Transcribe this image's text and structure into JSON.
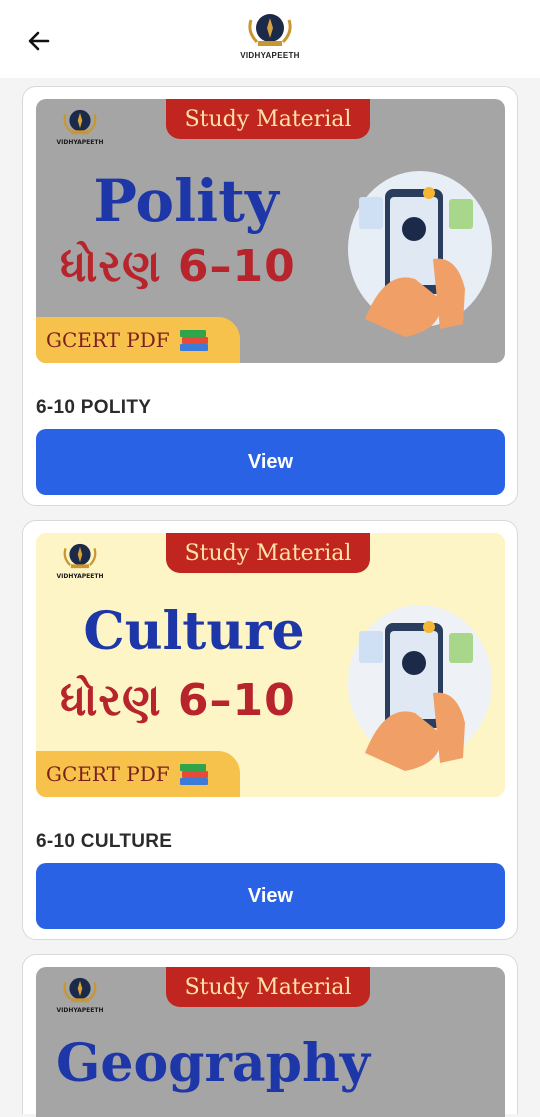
{
  "header": {
    "back_icon": "arrow-left-icon",
    "logo_text": "VIDHYAPEETH"
  },
  "cards": [
    {
      "pill": "Study Material",
      "logo_text": "VIDHYAPEETH",
      "subject": "Polity",
      "grade": "ધોરણ 6–10",
      "gcert": "GCERT PDF",
      "books_icon": "books-icon",
      "title": "6-10  POLITY",
      "button": "View",
      "banner_color": "#a5a5a5"
    },
    {
      "pill": "Study Material",
      "logo_text": "VIDHYAPEETH",
      "subject": "Culture",
      "grade": "ધોરણ 6–10",
      "gcert": "GCERT PDF",
      "books_icon": "books-icon",
      "title": "6-10 CULTURE",
      "button": "View",
      "banner_color": "#fdf5c6"
    },
    {
      "pill": "Study Material",
      "logo_text": "VIDHYAPEETH",
      "subject": "Geography",
      "banner_color": "#a5a5a5"
    }
  ],
  "colors": {
    "button": "#2a62e5",
    "pill": "#c0261f",
    "subject": "#1d36a8",
    "grade": "#b8242b",
    "gcert_bg": "#f7c24c"
  }
}
